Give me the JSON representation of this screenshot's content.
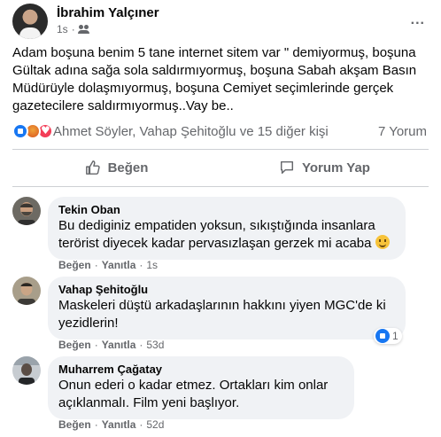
{
  "post": {
    "author": "İbrahim Yalçıner",
    "time": "1s",
    "privacy_icon": "friends-icon",
    "more_label": "...",
    "text": "Adam boşuna benim 5 tane internet sitem var \" demiyormuş, boşuna Gültak adına sağa sola saldırmıyormuş, boşuna Sabah akşam Basın Müdürüyle dolaşmıyormuş, boşuna Cemiyet seçimlerinde gerçek gazetecilere saldırmıyormuş..Vay be..",
    "reactions_text": "Ahmet Söyler, Vahap Şehitoğlu ve 15 diğer kişi",
    "comments_count": "7 Yorum"
  },
  "actions": {
    "like_label": "Beğen",
    "comment_label": "Yorum Yap"
  },
  "comments": [
    {
      "name": "Tekin Oban",
      "text": "Bu dediginiz empatiden yoksun, sıkıştığında insanlara terörist diyecek kadar pervasızlaşan gerzek mi acaba",
      "like": "Beğen",
      "reply": "Yanıtla",
      "time": "1s"
    },
    {
      "name": "Vahap Şehitoğlu",
      "text": "Maskeleri düştü arkadaşlarının hakkını yiyen MGC'de ki yezidlerin!",
      "like": "Beğen",
      "reply": "Yanıtla",
      "time": "53d",
      "reaction_count": "1"
    },
    {
      "name": "Muharrem Çağatay",
      "text": "Onun ederi o kadar etmez. Ortakları kim onlar açıklanmalı. Film yeni başlıyor.",
      "like": "Beğen",
      "reply": "Yanıtla",
      "time": "52d"
    }
  ],
  "separator": "·",
  "colors": {
    "accent": "#1877f2",
    "secondary_text": "#65676b",
    "bubble": "#f0f2f5"
  }
}
